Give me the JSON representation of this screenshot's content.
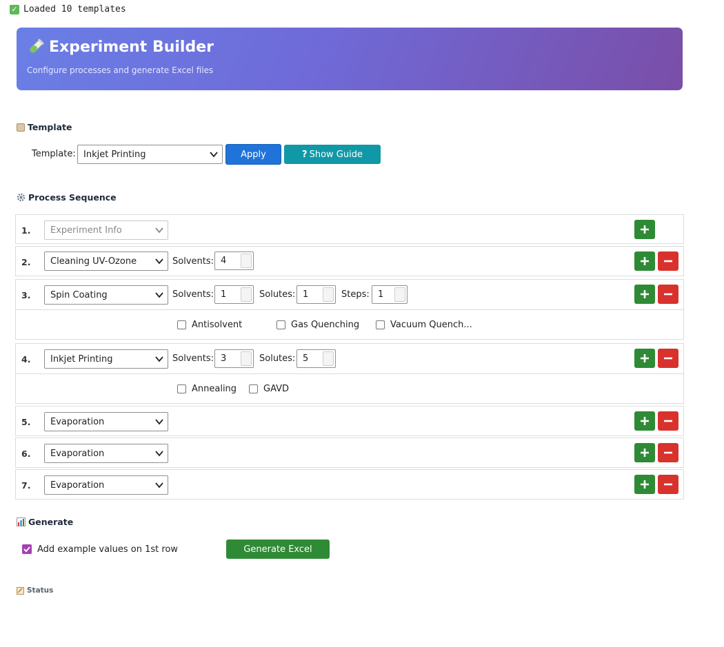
{
  "status_line": "Loaded 10 templates",
  "banner": {
    "title": "Experiment Builder",
    "subtitle": "Configure processes and generate Excel files"
  },
  "template_section": {
    "title": "Template",
    "label": "Template:",
    "selected": "Inkjet Printing",
    "apply_label": "Apply",
    "guide_label": "Show Guide"
  },
  "process_section": {
    "title": "Process Sequence",
    "rows": [
      {
        "num": "1.",
        "process": "Experiment Info"
      },
      {
        "num": "2.",
        "process": "Cleaning UV-Ozone",
        "solvents_label": "Solvents:",
        "solvents": "4"
      },
      {
        "num": "3.",
        "process": "Spin Coating",
        "solvents_label": "Solvents:",
        "solvents": "1",
        "solutes_label": "Solutes:",
        "solutes": "1",
        "steps_label": "Steps:",
        "steps": "1",
        "options": [
          "Antisolvent",
          "Gas Quenching",
          "Vacuum Quench..."
        ]
      },
      {
        "num": "4.",
        "process": "Inkjet Printing",
        "solvents_label": "Solvents:",
        "solvents": "3",
        "solutes_label": "Solutes:",
        "solutes": "5",
        "options": [
          "Annealing",
          "GAVD"
        ]
      },
      {
        "num": "5.",
        "process": "Evaporation"
      },
      {
        "num": "6.",
        "process": "Evaporation"
      },
      {
        "num": "7.",
        "process": "Evaporation"
      }
    ]
  },
  "generate_section": {
    "title": "Generate",
    "example_label": "Add example values on 1st row",
    "example_checked": true,
    "generate_label": "Generate Excel"
  },
  "status_section": {
    "title": "Status"
  },
  "colors": {
    "add": "#2f8a35",
    "remove": "#d9312c",
    "apply": "#1f73d9",
    "guide": "#1198a6",
    "generate": "#2f8a35",
    "checkbox": "#a63fb3"
  },
  "icons": [
    "check-icon",
    "test-tube-icon",
    "clipboard-icon",
    "gear-icon",
    "chart-icon",
    "memo-icon",
    "plus-icon",
    "minus-icon",
    "chevron-down-icon"
  ]
}
